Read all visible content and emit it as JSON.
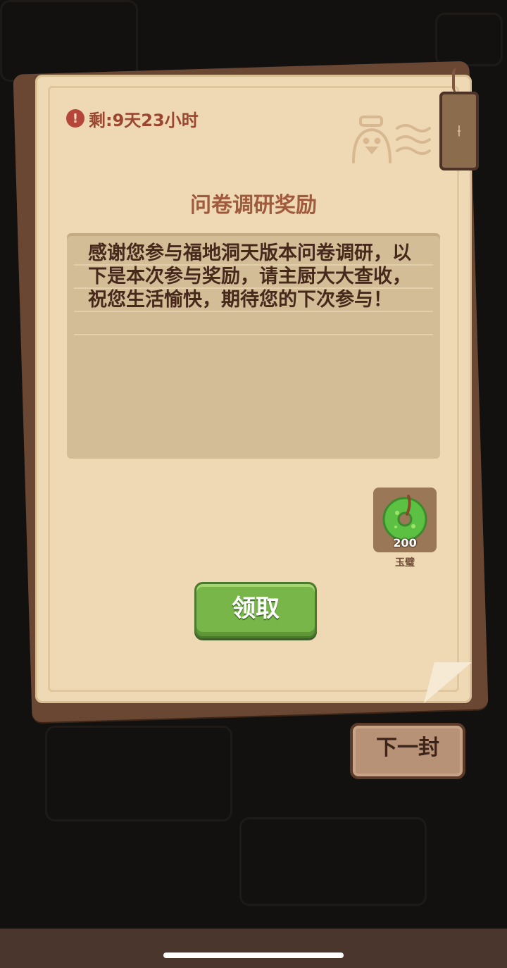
{
  "timer_text": "剩:9天23小时",
  "title": "问卷调研奖励",
  "message": "感谢您参与福地洞天版本问卷调研，以下是本次参与奖励，请主厨大大查收，祝您生活愉快，期待您的下次参与！",
  "reward": {
    "count": "200",
    "name": "玉璧"
  },
  "buttons": {
    "claim": "领取",
    "next": "下一封"
  },
  "icons": {
    "warning": "warning-icon",
    "stamp": "chef-bird-stamp-icon",
    "tag": "bookmark-tag-icon",
    "jade": "jade-disc-icon"
  },
  "colors": {
    "paper": "#eed9b4",
    "accent": "#a05a3d",
    "claim_button": "#78b64a"
  }
}
